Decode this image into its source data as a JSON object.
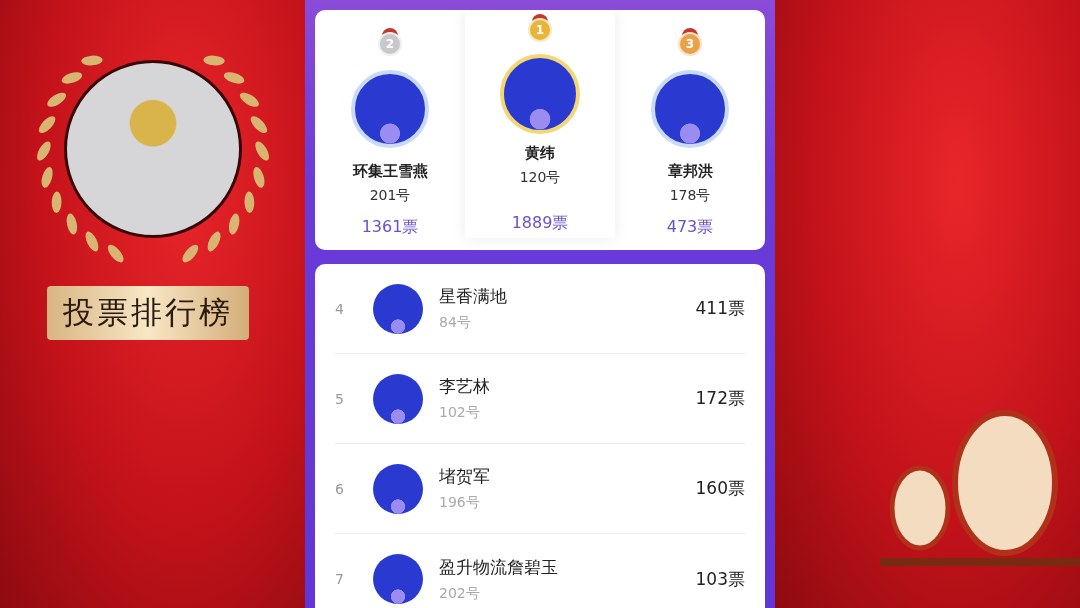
{
  "banner": {
    "title": "投票排行榜"
  },
  "podium": [
    {
      "rank": "2",
      "name": "环集王雪燕",
      "number": "201号",
      "votes": "1361票",
      "color": "#c8c8cc",
      "raised": false
    },
    {
      "rank": "1",
      "name": "黄纬",
      "number": "120号",
      "votes": "1889票",
      "color": "#e8b53a",
      "raised": true
    },
    {
      "rank": "3",
      "name": "章邦洪",
      "number": "178号",
      "votes": "473票",
      "color": "#eaa24a",
      "raised": false
    }
  ],
  "ranking": [
    {
      "rank": "4",
      "name": "星香满地",
      "number": "84号",
      "votes": "411票"
    },
    {
      "rank": "5",
      "name": "李艺林",
      "number": "102号",
      "votes": "172票"
    },
    {
      "rank": "6",
      "name": "堵贺军",
      "number": "196号",
      "votes": "160票"
    },
    {
      "rank": "7",
      "name": "盈升物流詹碧玉",
      "number": "202号",
      "votes": "103票"
    }
  ]
}
